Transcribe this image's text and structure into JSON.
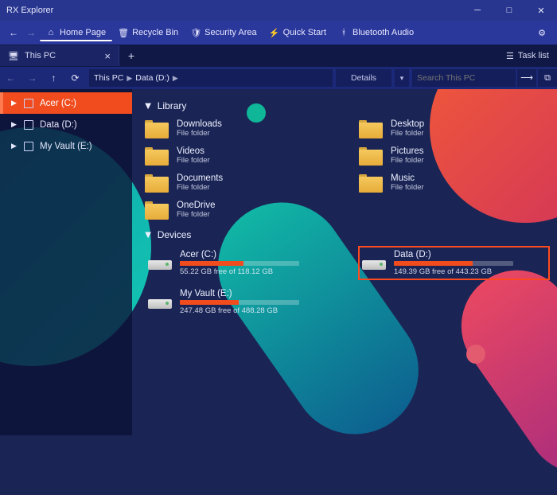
{
  "window": {
    "title": "RX Explorer"
  },
  "menu": {
    "home": "Home Page",
    "recycle": "Recycle Bin",
    "security": "Security Area",
    "quick": "Quick Start",
    "bluetooth": "Bluetooth Audio"
  },
  "tabs": {
    "active": "This PC",
    "tasklist": "Task list"
  },
  "toolbar": {
    "breadcrumb": [
      "This PC",
      "Data (D:)"
    ],
    "details": "Details",
    "search_placeholder": "Search This PC"
  },
  "sidebar": {
    "items": [
      {
        "label": "Acer (C:)",
        "selected": true
      },
      {
        "label": "Data (D:)",
        "selected": false
      },
      {
        "label": "My Vault (E:)",
        "selected": false
      }
    ]
  },
  "sections": {
    "library": {
      "title": "Library",
      "type_label": "File folder",
      "folders": [
        {
          "name": "Downloads"
        },
        {
          "name": "Desktop"
        },
        {
          "name": "Videos"
        },
        {
          "name": "Pictures"
        },
        {
          "name": "Documents"
        },
        {
          "name": "Music"
        },
        {
          "name": "OneDrive"
        }
      ]
    },
    "devices": {
      "title": "Devices",
      "drives": [
        {
          "name": "Acer (C:)",
          "free_text": "55.22 GB free of 118.12 GB",
          "used_percent": 53,
          "highlight": false
        },
        {
          "name": "Data (D:)",
          "free_text": "149.39 GB free of 443.23 GB",
          "used_percent": 66,
          "highlight": true
        },
        {
          "name": "My Vault (E:)",
          "free_text": "247.48 GB free of 488.28 GB",
          "used_percent": 49,
          "highlight": false
        }
      ]
    }
  }
}
